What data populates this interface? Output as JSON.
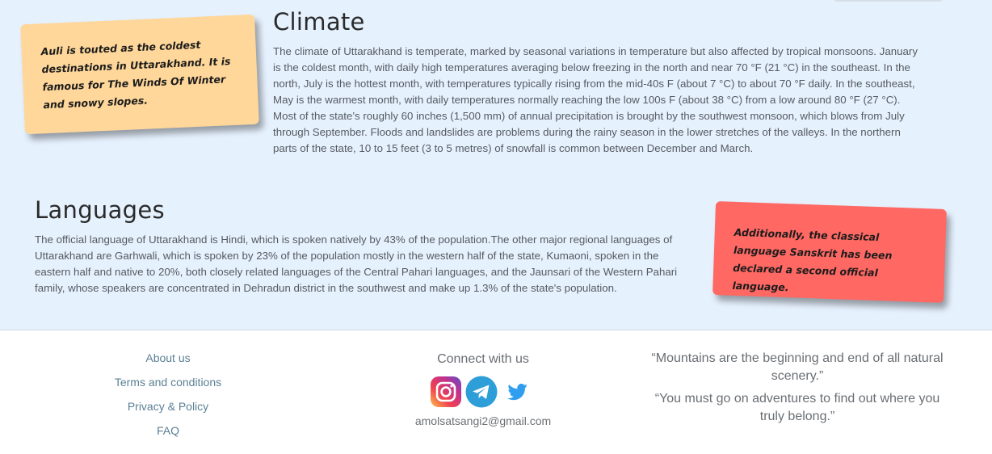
{
  "notes": {
    "auli": "Auli is touted as the coldest destinations in Uttarakhand. It is famous for The Winds Of Winter and snowy slopes.",
    "sanskrit": "Additionally, the classical language Sanskrit has been declared a second official language."
  },
  "climate": {
    "title": "Climate",
    "text": "The climate of Uttarakhand is temperate, marked by seasonal variations in temperature but also affected by tropical monsoons. January is the coldest month, with daily high temperatures averaging below freezing in the north and near 70 °F (21 °C) in the southeast. In the north, July is the hottest month, with temperatures typically rising from the mid-40s F (about 7 °C) to about 70 °F daily. In the southeast, May is the warmest month, with daily temperatures normally reaching the low 100s F (about 38 °C) from a low around 80 °F (27 °C). Most of the state’s roughly 60 inches (1,500 mm) of annual precipitation is brought by the southwest monsoon, which blows from July through September. Floods and landslides are problems during the rainy season in the lower stretches of the valleys. In the northern parts of the state, 10 to 15 feet (3 to 5 metres) of snowfall is common between December and March."
  },
  "languages": {
    "title": "Languages",
    "text": "The official language of Uttarakhand is Hindi, which is spoken natively by 43% of the population.The other major regional languages of Uttarakhand are Garhwali, which is spoken by 23% of the population mostly in the western half of the state, Kumaoni, spoken in the eastern half and native to 20%, both closely related languages of the Central Pahari languages, and the Jaunsari of the Western Pahari family, whose speakers are concentrated in Dehradun district in the southwest and make up 1.3% of the state's population."
  },
  "footer": {
    "links": [
      "About us",
      "Terms and conditions",
      "Privacy & Policy",
      "FAQ"
    ],
    "connect_title": "Connect with us",
    "social_icons": [
      "instagram-icon",
      "telegram-icon",
      "twitter-icon"
    ],
    "email": "amolsatsangi2@gmail.com",
    "quotes": [
      "“Mountains are the beginning and end of all natural scenery.”",
      "“You must go on adventures to find out where you truly belong.”"
    ]
  },
  "colors": {
    "section_bg": "#e6f1fe",
    "note_yellow": "#ffd79a",
    "note_red": "#ff6863",
    "link": "#5b7f95"
  }
}
